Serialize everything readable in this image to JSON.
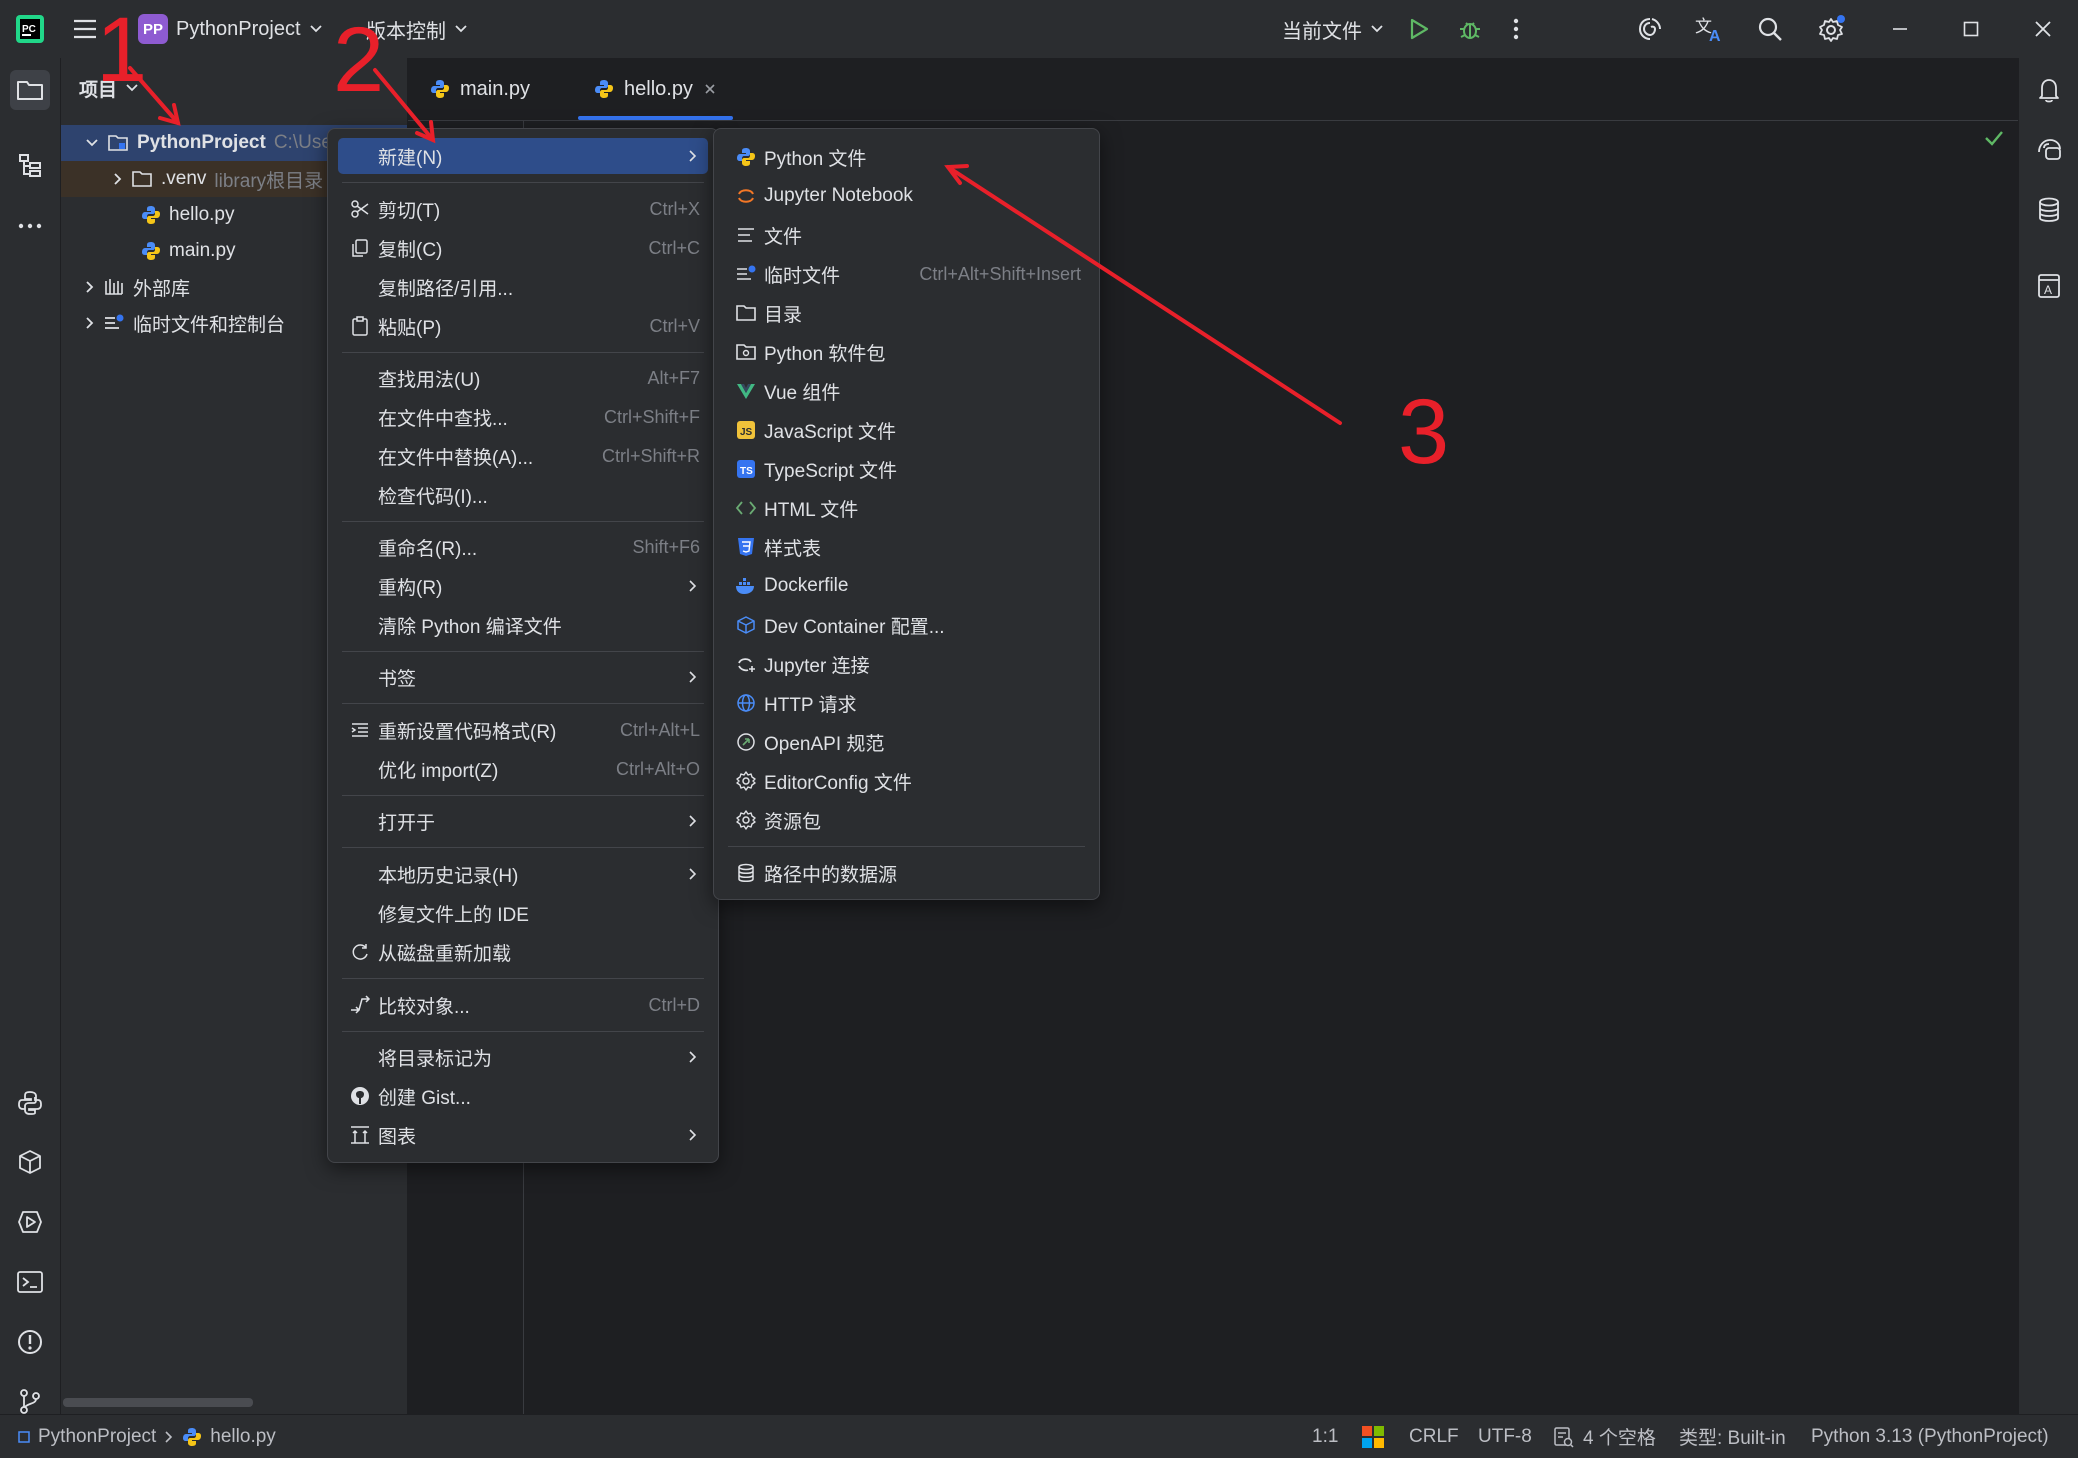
{
  "titlebar": {
    "project_name": "PythonProject",
    "project_badge": "PP",
    "vcs_label": "版本控制",
    "run_config": "当前文件"
  },
  "left_strip": {
    "top": [
      "folder-icon",
      "structure-icon",
      "more-icon"
    ],
    "bottom": [
      "python-console-icon",
      "python-packages-icon",
      "services-icon",
      "terminal-icon",
      "problems-icon",
      "git-icon"
    ]
  },
  "project_panel": {
    "title": "项目",
    "rows": [
      {
        "label": "PythonProject",
        "extra": "C:\\Use"
      },
      {
        "label": ".venv",
        "extra": "library根目录"
      },
      {
        "label": "hello.py",
        "extra": ""
      },
      {
        "label": "main.py",
        "extra": ""
      },
      {
        "label": "外部库",
        "extra": ""
      },
      {
        "label": "临时文件和控制台",
        "extra": ""
      }
    ]
  },
  "tabs": [
    {
      "label": "main.py"
    },
    {
      "label": "hello.py"
    }
  ],
  "context_menu": {
    "items": [
      {
        "label": "新建(N)",
        "shortcut": "",
        "submenu": true
      },
      {
        "label": "剪切(T)",
        "shortcut": "Ctrl+X"
      },
      {
        "label": "复制(C)",
        "shortcut": "Ctrl+C"
      },
      {
        "label": "复制路径/引用...",
        "shortcut": ""
      },
      {
        "label": "粘贴(P)",
        "shortcut": "Ctrl+V"
      },
      {
        "label": "查找用法(U)",
        "shortcut": "Alt+F7"
      },
      {
        "label": "在文件中查找...",
        "shortcut": "Ctrl+Shift+F"
      },
      {
        "label": "在文件中替换(A)...",
        "shortcut": "Ctrl+Shift+R"
      },
      {
        "label": "检查代码(I)...",
        "shortcut": ""
      },
      {
        "label": "重命名(R)...",
        "shortcut": "Shift+F6"
      },
      {
        "label": "重构(R)",
        "shortcut": "",
        "submenu": true
      },
      {
        "label": "清除 Python 编译文件",
        "shortcut": ""
      },
      {
        "label": "书签",
        "shortcut": "",
        "submenu": true
      },
      {
        "label": "重新设置代码格式(R)",
        "shortcut": "Ctrl+Alt+L"
      },
      {
        "label": "优化 import(Z)",
        "shortcut": "Ctrl+Alt+O"
      },
      {
        "label": "打开于",
        "shortcut": "",
        "submenu": true
      },
      {
        "label": "本地历史记录(H)",
        "shortcut": "",
        "submenu": true
      },
      {
        "label": "修复文件上的 IDE",
        "shortcut": ""
      },
      {
        "label": "从磁盘重新加载",
        "shortcut": ""
      },
      {
        "label": "比较对象...",
        "shortcut": "Ctrl+D"
      },
      {
        "label": "将目录标记为",
        "shortcut": "",
        "submenu": true
      },
      {
        "label": "创建 Gist...",
        "shortcut": ""
      },
      {
        "label": "图表",
        "shortcut": "",
        "submenu": true
      }
    ]
  },
  "new_submenu": {
    "items": [
      {
        "label": "Python 文件",
        "shortcut": ""
      },
      {
        "label": "Jupyter Notebook",
        "shortcut": ""
      },
      {
        "label": "文件",
        "shortcut": ""
      },
      {
        "label": "临时文件",
        "shortcut": "Ctrl+Alt+Shift+Insert"
      },
      {
        "label": "目录",
        "shortcut": ""
      },
      {
        "label": "Python 软件包",
        "shortcut": ""
      },
      {
        "label": "Vue 组件",
        "shortcut": ""
      },
      {
        "label": "JavaScript 文件",
        "shortcut": ""
      },
      {
        "label": "TypeScript 文件",
        "shortcut": ""
      },
      {
        "label": "HTML 文件",
        "shortcut": ""
      },
      {
        "label": "样式表",
        "shortcut": ""
      },
      {
        "label": "Dockerfile",
        "shortcut": ""
      },
      {
        "label": "Dev Container 配置...",
        "shortcut": ""
      },
      {
        "label": "Jupyter 连接",
        "shortcut": ""
      },
      {
        "label": "HTTP 请求",
        "shortcut": ""
      },
      {
        "label": "OpenAPI 规范",
        "shortcut": ""
      },
      {
        "label": "EditorConfig 文件",
        "shortcut": ""
      },
      {
        "label": "资源包",
        "shortcut": ""
      },
      {
        "label": "路径中的数据源",
        "shortcut": ""
      }
    ]
  },
  "annotations": [
    "1",
    "2",
    "3"
  ],
  "statusbar": {
    "breadcrumb_project": "PythonProject",
    "breadcrumb_file": "hello.py",
    "position": "1:1",
    "line_sep": "CRLF",
    "encoding": "UTF-8",
    "indent": "4 个空格",
    "file_type": "类型: Built-in",
    "interpreter": "Python 3.13 (PythonProject)"
  },
  "colors": {
    "accent": "#3574f0",
    "annotation_red": "#e8202a",
    "menu_highlight": "#2e4d8a"
  }
}
